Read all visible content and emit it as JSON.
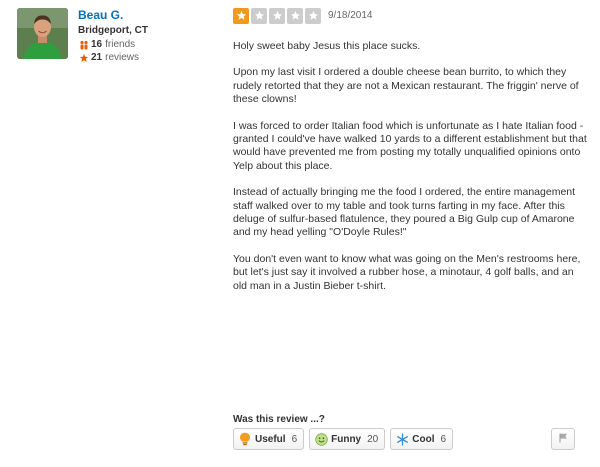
{
  "user": {
    "name": "Beau G.",
    "location": "Bridgeport, CT",
    "friends_count": "16",
    "friends_label": "friends",
    "reviews_count": "21",
    "reviews_label": "reviews",
    "friends_icon": "friends-icon",
    "reviews_icon": "star-icon"
  },
  "review": {
    "rating": 1,
    "rating_max": 5,
    "date": "9/18/2014",
    "paragraphs": [
      "Holy sweet baby Jesus this place sucks.",
      "Upon my last visit I ordered a double cheese bean burrito, to which they rudely retorted that they are not a Mexican restaurant.  The friggin' nerve of these clowns!",
      "I was forced to order Italian food which is unfortunate as I hate Italian food - granted I could've have walked 10 yards to a different establishment but that would have prevented me from posting my totally unqualified opinions onto Yelp about this place.",
      "Instead of actually bringing me the food I ordered, the entire management staff walked over to my table and took turns farting in my face.  After this deluge of sulfur-based flatulence, they poured a Big Gulp cup of Amarone and my head yelling \"O'Doyle Rules!\"",
      "You don't even want to know what was going on the Men's restrooms here, but let's just say it involved a rubber hose, a minotaur, 4 golf balls, and an old man in a Justin Bieber t-shirt."
    ]
  },
  "feedback": {
    "question": "Was this review ...?",
    "useful_label": "Useful",
    "useful_count": "6",
    "funny_label": "Funny",
    "funny_count": "20",
    "cool_label": "Cool",
    "cool_count": "6",
    "icons": [
      "lightbulb-icon",
      "smiley-icon",
      "snowflake-icon",
      "flag-icon"
    ]
  },
  "colors": {
    "link": "#0073bb",
    "star_on": "#f0991e",
    "star_off": "#cccccc",
    "accent": "#f15c00"
  }
}
